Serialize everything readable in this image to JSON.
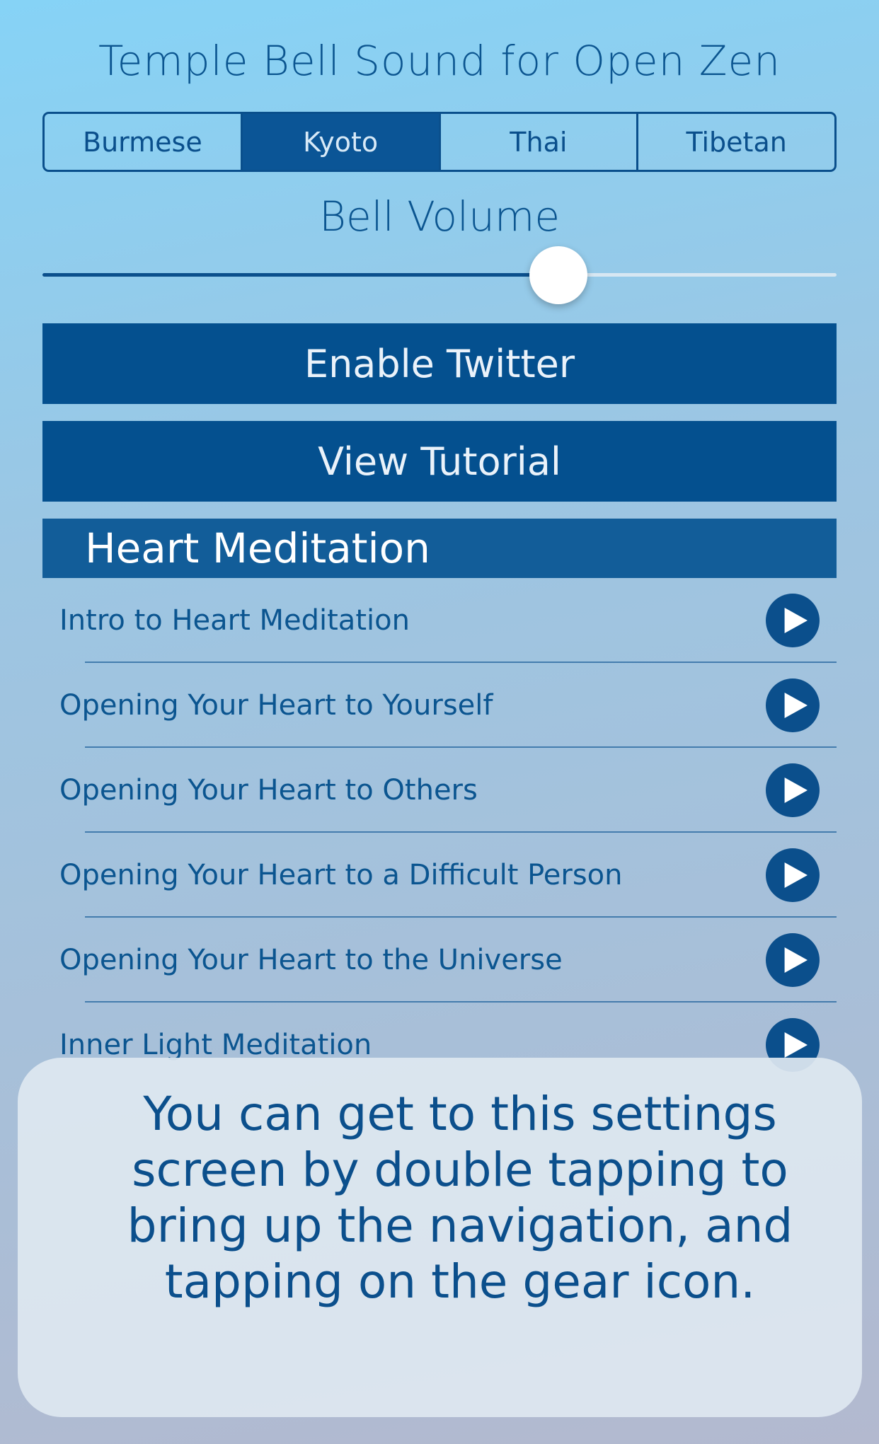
{
  "title": "Temple Bell Sound for Open Zen",
  "bell_sounds": {
    "options": [
      "Burmese",
      "Kyoto",
      "Thai",
      "Tibetan"
    ],
    "selected": "Kyoto"
  },
  "volume": {
    "label": "Bell Volume",
    "value": 0.65
  },
  "buttons": {
    "twitter": "Enable Twitter",
    "tutorial": "View Tutorial"
  },
  "section": {
    "title": "Heart Meditation",
    "items": [
      {
        "label": "Intro to Heart Meditation",
        "icon": "play-icon"
      },
      {
        "label": "Opening Your Heart to Yourself",
        "icon": "play-icon"
      },
      {
        "label": "Opening Your Heart to Others",
        "icon": "play-icon"
      },
      {
        "label": "Opening Your Heart to a Difficult Person",
        "icon": "play-icon"
      },
      {
        "label": "Opening Your Heart to the Universe",
        "icon": "play-icon"
      },
      {
        "label": "Inner Light Meditation",
        "icon": "play-icon"
      }
    ]
  },
  "tip": {
    "text": "You can get to this settings screen by double tapping to bring up the navigation, and tapping on the gear icon."
  },
  "colors": {
    "accent": "#0b4f8c",
    "button": "#04508f",
    "header": "#125d99"
  }
}
